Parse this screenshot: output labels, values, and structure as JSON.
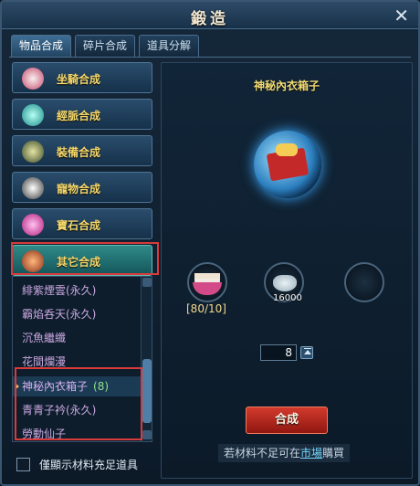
{
  "window": {
    "title": "鍛造"
  },
  "tabs": [
    {
      "label": "物品合成",
      "active": true
    },
    {
      "label": "碎片合成",
      "active": false
    },
    {
      "label": "道具分解",
      "active": false
    }
  ],
  "categories": [
    {
      "label": "坐騎合成",
      "icon": "horse-icon"
    },
    {
      "label": "經脈合成",
      "icon": "orb-icon"
    },
    {
      "label": "裝備合成",
      "icon": "armor-icon"
    },
    {
      "label": "寵物合成",
      "icon": "panda-icon"
    },
    {
      "label": "寶石合成",
      "icon": "gem-icon"
    },
    {
      "label": "其它合成",
      "icon": "item-icon",
      "active": true
    }
  ],
  "items_list": [
    {
      "label": "緋紫煙雲(永久)"
    },
    {
      "label": "霸焰呑天(永久)"
    },
    {
      "label": "沉魚繼纖"
    },
    {
      "label": "花間爛漫"
    },
    {
      "label": "神秘內衣箱子",
      "count": "(8)",
      "selected": true
    },
    {
      "label": "青青子衿(永久)"
    },
    {
      "label": "勞動仙子"
    }
  ],
  "checkbox": {
    "label": "僅顯示材料充足道具"
  },
  "detail": {
    "item_title": "神秘內衣箱子",
    "material_1_quantity": "[80/10]",
    "material_2_count": "16000",
    "quantity_value": "8",
    "craft_label": "合成",
    "hint_prefix": "若材料不足可在",
    "hint_link": "市場",
    "hint_suffix": "購買"
  },
  "colors": {
    "accent_gold": "#f6d86a",
    "highlight_red": "#d93a3a",
    "craft_red": "#d23a2d"
  }
}
